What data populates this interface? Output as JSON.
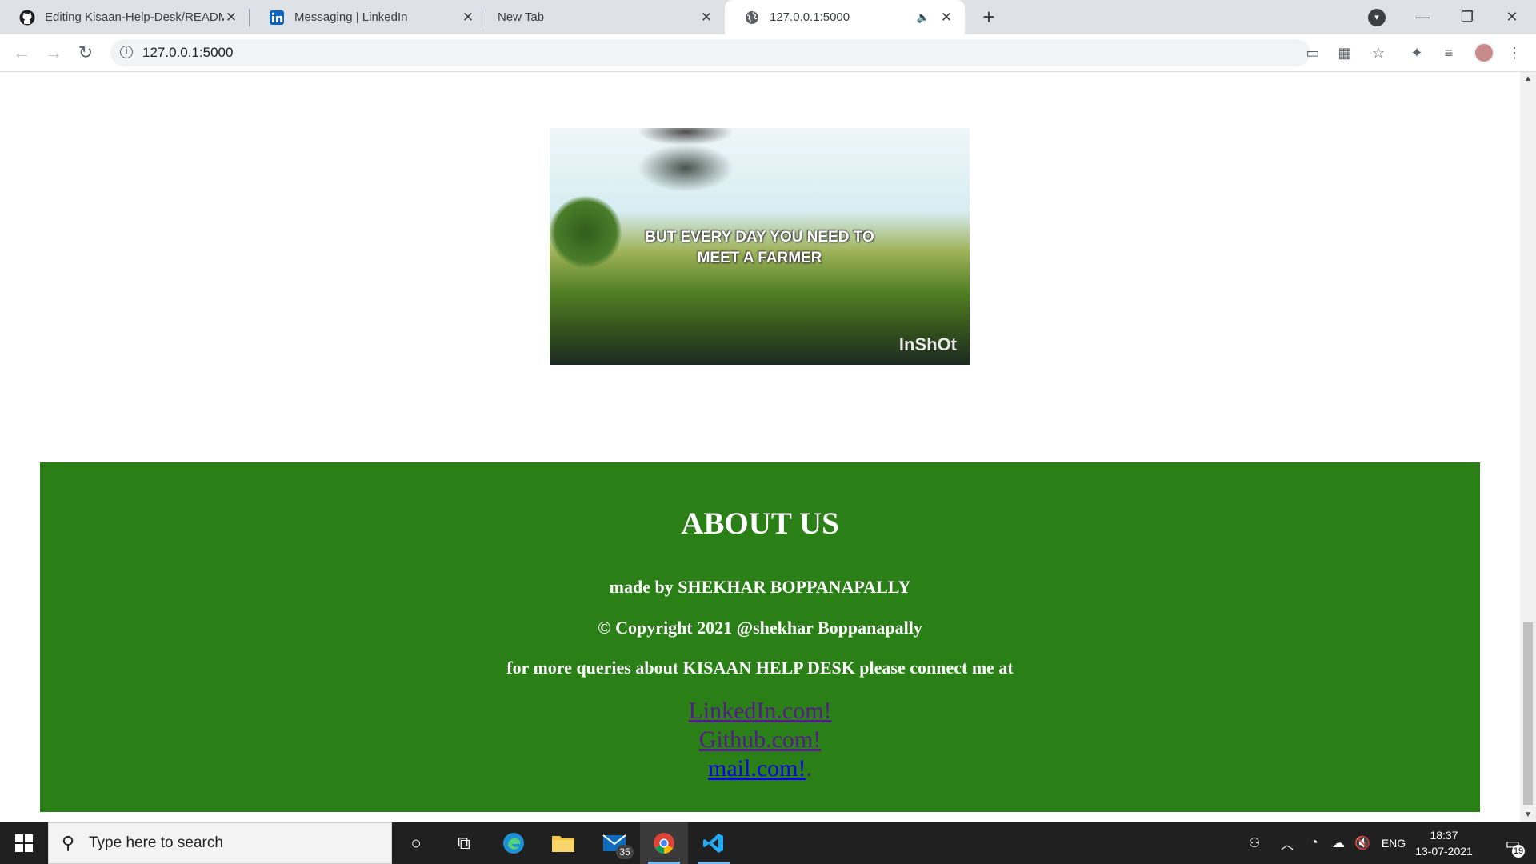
{
  "browser": {
    "tabs": [
      {
        "title": "Editing Kisaan-Help-Desk/READM",
        "favicon": "github-icon"
      },
      {
        "title": "Messaging | LinkedIn",
        "favicon": "linkedin-icon"
      },
      {
        "title": "New Tab",
        "favicon": ""
      },
      {
        "title": "127.0.0.1:5000",
        "favicon": "globe-icon",
        "active": true,
        "muted": true
      }
    ],
    "url": "127.0.0.1:5000",
    "colors": {
      "tabstrip": "#dee1e6",
      "toolbar": "#ffffff"
    }
  },
  "page": {
    "video": {
      "caption": "BUT EVERY DAY YOU NEED TO\nMEET A FARMER",
      "watermark": "InShOt"
    },
    "about": {
      "heading": "ABOUT US",
      "made_by": "made by SHEKHAR BOPPANAPALLY",
      "copyright": "© Copyright 2021 @shekhar Boppanapally",
      "queries": "for more queries about KISAAN HELP DESK please connect me at",
      "links": [
        "LinkedIn.com!",
        "Github.com!",
        "mail.com!"
      ],
      "trailing": ".",
      "background": "#2a7f17"
    }
  },
  "taskbar": {
    "search_placeholder": "Type here to search",
    "mail_badge": "35",
    "language": "ENG",
    "time": "18:37",
    "date": "13-07-2021",
    "notifications": "19"
  }
}
